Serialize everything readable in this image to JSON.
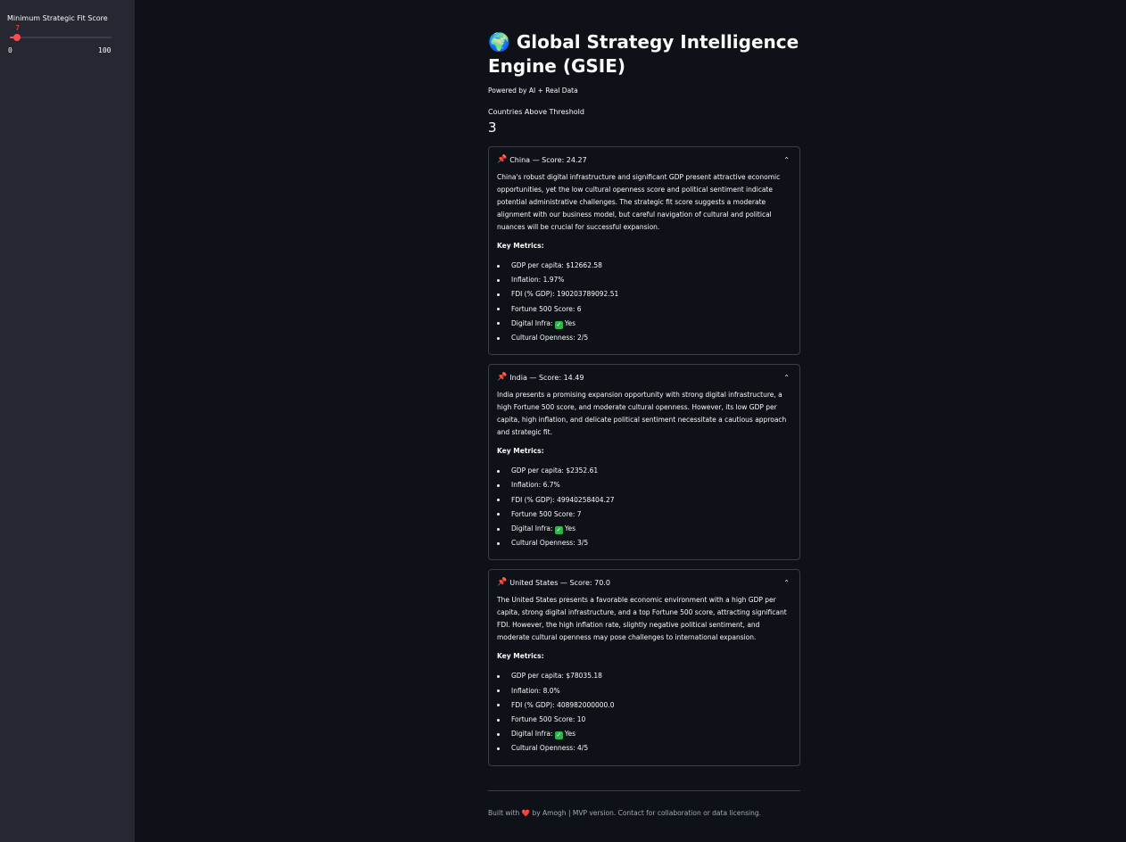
{
  "sidebar": {
    "slider": {
      "label": "Minimum Strategic Fit Score",
      "value": "7",
      "min": "0",
      "max": "100",
      "fraction": 0.07,
      "accent_color": "#ff4b4b"
    }
  },
  "header": {
    "title": "🌍 Global Strategy Intelligence Engine (GSIE)",
    "subtitle": "Powered by AI + Real Data"
  },
  "metric": {
    "label": "Countries Above Threshold",
    "value": "3"
  },
  "expanders": [
    {
      "title": "China — Score: 24.27",
      "summary": "China's robust digital infrastructure and significant GDP present attractive economic opportunities, yet the low cultural openness score and political sentiment indicate potential administrative challenges. The strategic fit score suggests a moderate alignment with our business model, but careful navigation of cultural and political nuances will be crucial for successful expansion.",
      "key_metrics_label": "Key Metrics:",
      "metrics": [
        "GDP per capita: $12662.58",
        "Inflation: 1.97%",
        "FDI (% GDP): 190203789092.51",
        "Fortune 500 Score: 6",
        "Yes",
        "Cultural Openness: 2/5"
      ],
      "digital_infra_label": "Digital Infra:"
    },
    {
      "title": "India — Score: 14.49",
      "summary": "India presents a promising expansion opportunity with strong digital infrastructure, a high Fortune 500 score, and moderate cultural openness. However, its low GDP per capita, high inflation, and delicate political sentiment necessitate a cautious approach and strategic fit.",
      "key_metrics_label": "Key Metrics:",
      "metrics": [
        "GDP per capita: $2352.61",
        "Inflation: 6.7%",
        "FDI (% GDP): 49940258404.27",
        "Fortune 500 Score: 7",
        "Yes",
        "Cultural Openness: 3/5"
      ],
      "digital_infra_label": "Digital Infra:"
    },
    {
      "title": "United States — Score: 70.0",
      "summary": "The United States presents a favorable economic environment with a high GDP per capita, strong digital infrastructure, and a top Fortune 500 score, attracting significant FDI. However, the high inflation rate, slightly negative political sentiment, and moderate cultural openness may pose challenges to international expansion.",
      "key_metrics_label": "Key Metrics:",
      "metrics": [
        "GDP per capita: $78035.18",
        "Inflation: 8.0%",
        "FDI (% GDP): 408982000000.0",
        "Fortune 500 Score: 10",
        "Yes",
        "Cultural Openness: 4/5"
      ],
      "digital_infra_label": "Digital Infra:"
    }
  ],
  "footer": {
    "built_with": "Built with",
    "rest": "by Amogh | MVP version. Contact for collaboration or data licensing."
  },
  "icons": {
    "pin": "pushpin-icon",
    "chevron": "chevron-up-icon",
    "check": "check-icon",
    "heart": "heart-icon"
  }
}
